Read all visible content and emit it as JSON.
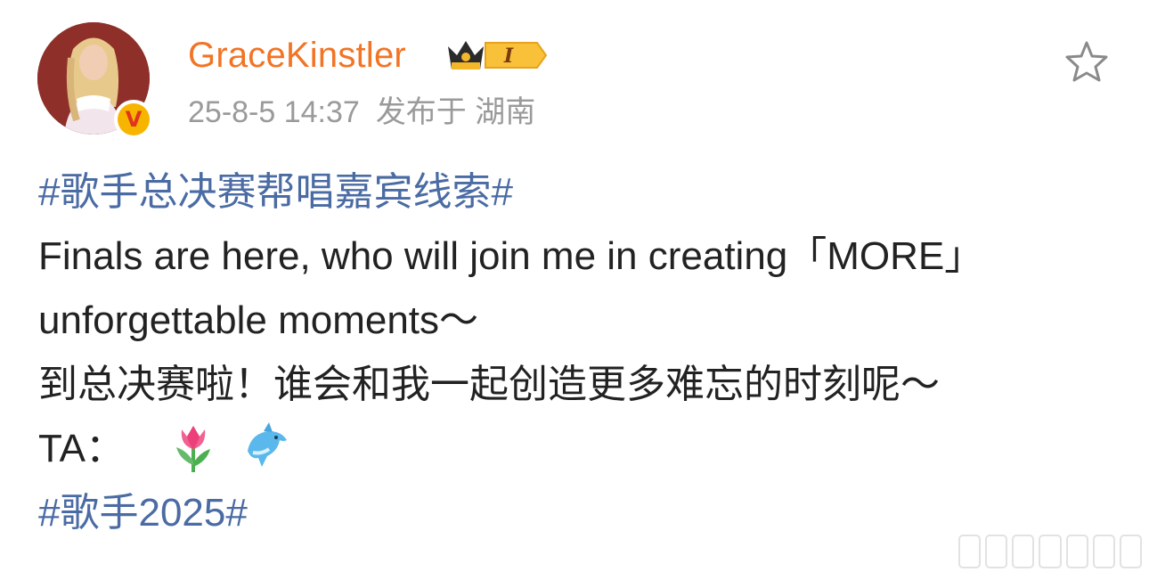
{
  "post": {
    "author": {
      "username": "GraceKinstler",
      "avatar_icon": "avatar-image",
      "verified_badge": "V",
      "vip_level": "I"
    },
    "meta": {
      "timestamp": "25-8-5 14:37",
      "location_label": "发布于 湖南"
    },
    "favorite_icon": "star-outline-icon",
    "content": {
      "hashtag_top": "#歌手总决赛帮唱嘉宾线索#",
      "english_line1": "Finals are here, who will join me in creating「MORE」",
      "english_line2": "unforgettable moments～",
      "chinese_line": "到总决赛啦！谁会和我一起创造更多难忘的时刻呢～",
      "ta_prefix": "TA：",
      "emojis": [
        "tulip-emoji",
        "dolphin-emoji"
      ],
      "hashtag_bottom": "#歌手2025#"
    }
  },
  "colors": {
    "username": "#f27425",
    "hashtag": "#4a6ba3",
    "meta": "#9a9a9a",
    "body_text": "#222222",
    "verified_gold": "#f7b500"
  }
}
